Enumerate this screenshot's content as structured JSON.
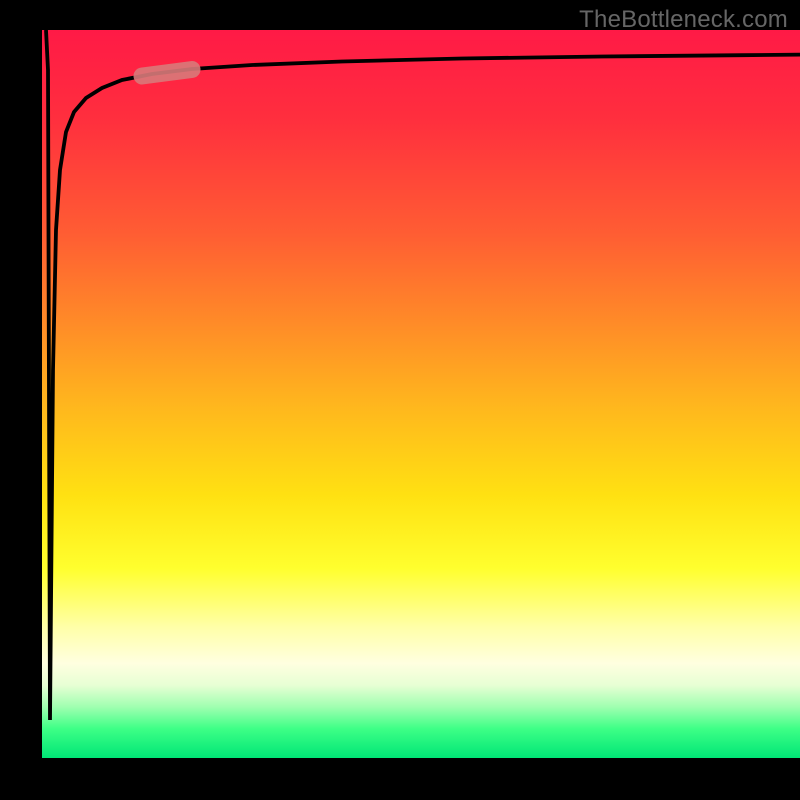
{
  "watermark": "TheBottleneck.com",
  "chart_data": {
    "type": "line",
    "title": "",
    "xlabel": "",
    "ylabel": "",
    "xlim": [
      0,
      100
    ],
    "ylim": [
      0,
      100
    ],
    "grid": false,
    "series": [
      {
        "name": "bottleneck-curve",
        "x": [
          0.5,
          0.8,
          1.0,
          1.3,
          1.7,
          2.2,
          3.0,
          4.0,
          5.5,
          7.5,
          10,
          14,
          20,
          30,
          45,
          65,
          85,
          100
        ],
        "y": [
          98,
          45,
          20,
          40,
          60,
          72,
          80,
          85,
          88,
          90,
          91.3,
          92.5,
          93.5,
          94.3,
          95,
          95.5,
          95.8,
          96
        ]
      }
    ],
    "marker": {
      "x": 15,
      "y": 92.8
    },
    "background_gradient": {
      "direction": "vertical",
      "stops": [
        {
          "pos": 0.0,
          "color": "#ff1a46"
        },
        {
          "pos": 0.5,
          "color": "#ffe112"
        },
        {
          "pos": 0.87,
          "color": "#ffffe0"
        },
        {
          "pos": 1.0,
          "color": "#00e676"
        }
      ]
    }
  }
}
